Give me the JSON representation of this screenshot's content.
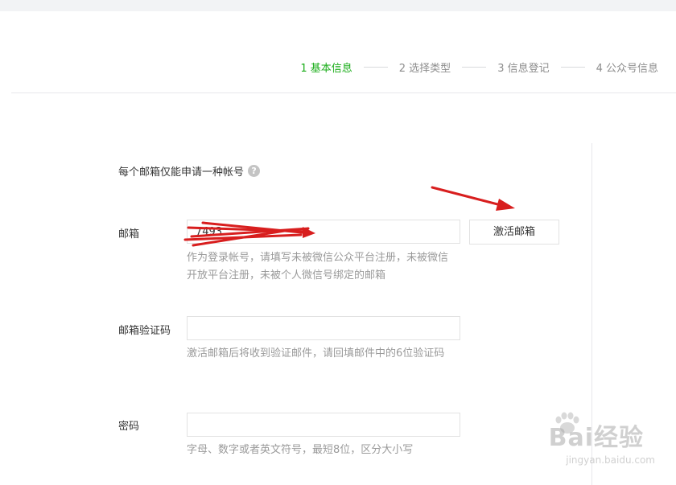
{
  "steps": [
    {
      "label": "1 基本信息",
      "active": true
    },
    {
      "label": "2 选择类型",
      "active": false
    },
    {
      "label": "3 信息登记",
      "active": false
    },
    {
      "label": "4 公众号信息",
      "active": false
    }
  ],
  "notice": {
    "text": "每个邮箱仅能申请一种帐号",
    "icon": "help-icon"
  },
  "form": {
    "email": {
      "label": "邮箱",
      "value": "7493",
      "tip": "作为登录帐号，请填写未被微信公众平台注册，未被微信开放平台注册，未被个人微信号绑定的邮箱",
      "button": "激活邮箱"
    },
    "code": {
      "label": "邮箱验证码",
      "value": "",
      "tip": "激活邮箱后将收到验证邮件，请回填邮件中的6位验证码"
    },
    "password": {
      "label": "密码",
      "value": "",
      "tip": "字母、数字或者英文符号，最短8位，区分大小写"
    }
  },
  "watermark": {
    "main": "Bai经验",
    "sub": "jingyan.baidu.com"
  },
  "colors": {
    "active_step": "#1aad19",
    "annotation_arrow": "#d81e1e"
  }
}
